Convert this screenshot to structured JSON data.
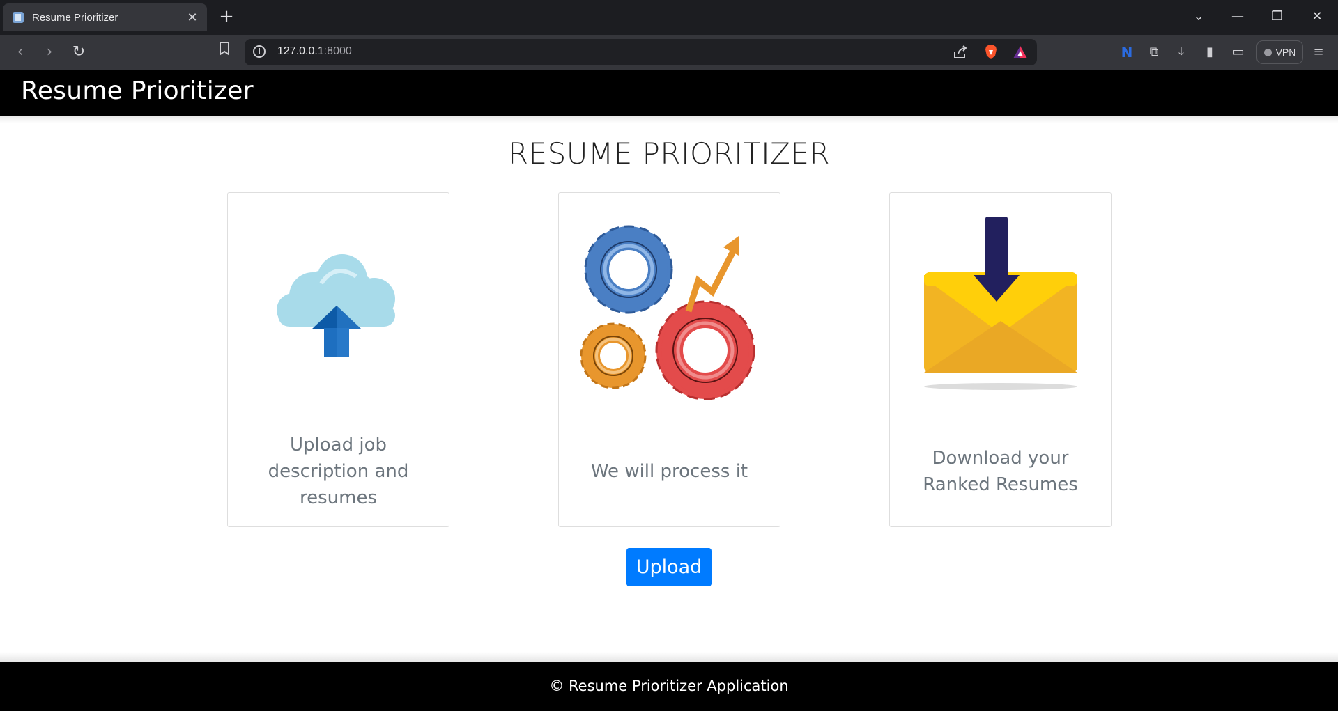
{
  "browser": {
    "tab_title": "Resume Prioritizer",
    "url_host": "127.0.0.1",
    "url_port": ":8000",
    "vpn_label": "VPN"
  },
  "navbar": {
    "brand": "Resume Prioritizer"
  },
  "main": {
    "heading": "RESUME PRIORITIZER",
    "cards": [
      {
        "icon": "cloud-upload-icon",
        "text": "Upload job description and resumes"
      },
      {
        "icon": "gears-process-icon",
        "text": "We will process it"
      },
      {
        "icon": "envelope-download-icon",
        "text": "Download your Ranked Resumes"
      }
    ],
    "upload_button": "Upload"
  },
  "footer": {
    "text": "© Resume Prioritizer Application"
  },
  "colors": {
    "primary": "#007bff",
    "navbar": "#000000",
    "muted_text": "#6c757d"
  }
}
